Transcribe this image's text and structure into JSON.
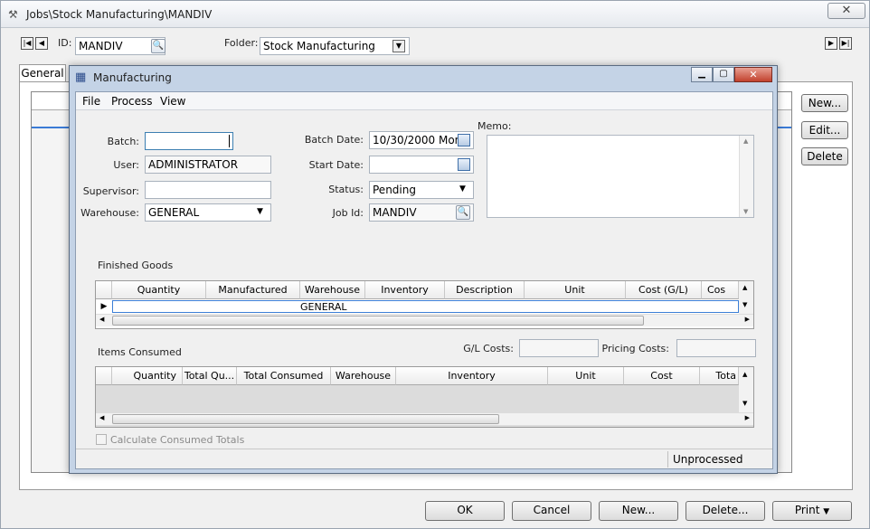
{
  "outer": {
    "title": "Jobs\\Stock Manufacturing\\MANDIV",
    "id_label": "ID:",
    "id_value": "MANDIV",
    "folder_label": "Folder:",
    "folder_value": "Stock Manufacturing",
    "tab_general": "General",
    "side_buttons": {
      "new": "New...",
      "edit": "Edit...",
      "delete": "Delete"
    },
    "bottom_buttons": {
      "ok": "OK",
      "cancel": "Cancel",
      "new": "New...",
      "delete": "Delete...",
      "print": "Print"
    }
  },
  "dialog": {
    "title": "Manufacturing",
    "menu": [
      "File",
      "Process",
      "View"
    ],
    "batch_label": "Batch:",
    "batch_value": "",
    "user_label": "User:",
    "user_value": "ADMINISTRATOR",
    "supervisor_label": "Supervisor:",
    "supervisor_value": "",
    "warehouse_label": "Warehouse:",
    "warehouse_value": "GENERAL",
    "batch_date_label": "Batch Date:",
    "batch_date_value": "10/30/2000 Mon",
    "start_date_label": "Start Date:",
    "start_date_value": "",
    "status_label": "Status:",
    "status_value": "Pending",
    "job_id_label": "Job Id:",
    "job_id_value": "MANDIV",
    "memo_label": "Memo:",
    "finished_goods_label": "Finished Goods",
    "fg_columns": [
      "Quantity",
      "Manufactured",
      "Warehouse",
      "Inventory",
      "Description",
      "Unit",
      "Cost (G/L)",
      "Cos"
    ],
    "fg_row_warehouse": "GENERAL",
    "items_consumed_label": "Items Consumed",
    "gl_costs_label": "G/L Costs:",
    "pricing_costs_label": "Pricing Costs:",
    "ic_columns": [
      "Quantity",
      "Total Qu...",
      "Total Consumed",
      "Warehouse",
      "Inventory",
      "Unit",
      "Cost",
      "Tota"
    ],
    "calc_label": "Calculate Consumed Totals",
    "status_bar": "Unprocessed"
  }
}
